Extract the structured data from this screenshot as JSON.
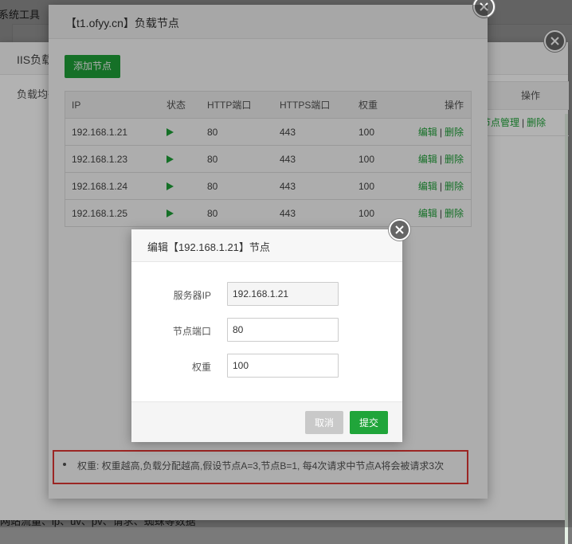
{
  "background": {
    "topbar_text": "系统工具",
    "bottom_text": "网站流量、ip、uv、pv、请求、蜘蛛等数据"
  },
  "iis_panel": {
    "title": "IIS负载",
    "tab": "负载均衡",
    "th_op": "操作",
    "row_link_manage": "节点管理",
    "row_link_delete": "删除"
  },
  "main_modal": {
    "title": "【t1.ofyy.cn】负载节点",
    "add_button": "添加节点",
    "columns": [
      "IP",
      "状态",
      "HTTP端口",
      "HTTPS端口",
      "权重",
      "操作"
    ],
    "rows": [
      {
        "ip": "192.168.1.21",
        "http": "80",
        "https": "443",
        "weight": "100",
        "edit": "编辑",
        "delete": "删除"
      },
      {
        "ip": "192.168.1.23",
        "http": "80",
        "https": "443",
        "weight": "100",
        "edit": "编辑",
        "delete": "删除"
      },
      {
        "ip": "192.168.1.24",
        "http": "80",
        "https": "443",
        "weight": "100",
        "edit": "编辑",
        "delete": "删除"
      },
      {
        "ip": "192.168.1.25",
        "http": "80",
        "https": "443",
        "weight": "100",
        "edit": "编辑",
        "delete": "删除"
      }
    ],
    "separator": "|",
    "tip": "权重: 权重越高,负载分配越高,假设节点A=3,节点B=1, 每4次请求中节点A将会被请求3次"
  },
  "edit_dialog": {
    "title": "编辑【192.168.1.21】节点",
    "fields": {
      "server_ip": {
        "label": "服务器IP",
        "value": "192.168.1.21"
      },
      "port": {
        "label": "节点端口",
        "value": "80"
      },
      "weight": {
        "label": "权重",
        "value": "100"
      }
    },
    "cancel": "取消",
    "submit": "提交"
  },
  "colors": {
    "accent_green": "#20a53a",
    "highlight_red": "#e53935"
  }
}
